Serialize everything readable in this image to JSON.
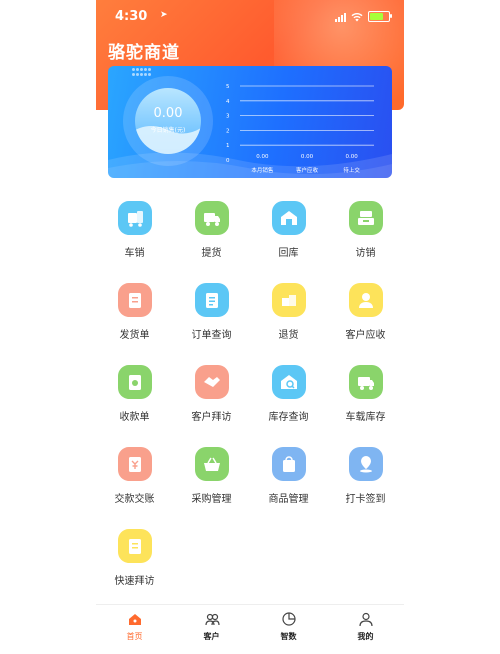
{
  "status_bar": {
    "time": "4:30",
    "location_glyph": "➤"
  },
  "header": {
    "title": "骆驼商道"
  },
  "summary_card": {
    "gauge_value": "0.00",
    "gauge_label": "今日销售(元)"
  },
  "chart_data": {
    "type": "bar",
    "categories": [
      "本月销售",
      "客户应收",
      "待上交"
    ],
    "values": [
      0.0,
      0.0,
      0.0
    ],
    "value_labels": [
      "0.00",
      "0.00",
      "0.00"
    ],
    "ylim": [
      0,
      5
    ],
    "yticks": [
      "0",
      "1",
      "2",
      "3",
      "4",
      "5"
    ],
    "grid": true,
    "title": "",
    "xlabel": "",
    "ylabel": ""
  },
  "menu": [
    {
      "label": "车销",
      "icon": "truck-doc-icon",
      "color": "#5cc7f5"
    },
    {
      "label": "提货",
      "icon": "truck-load-icon",
      "color": "#8ad46b"
    },
    {
      "label": "回库",
      "icon": "warehouse-icon",
      "color": "#5cc7f5"
    },
    {
      "label": "访销",
      "icon": "register-icon",
      "color": "#8ad46b"
    },
    {
      "label": "发货单",
      "icon": "invoice-icon",
      "color": "#f9a08c"
    },
    {
      "label": "订单查询",
      "icon": "order-list-icon",
      "color": "#5cc7f5"
    },
    {
      "label": "退货",
      "icon": "return-boxes-icon",
      "color": "#fde35a"
    },
    {
      "label": "客户应收",
      "icon": "receivable-icon",
      "color": "#fde35a"
    },
    {
      "label": "收款单",
      "icon": "receipt-icon",
      "color": "#8ad46b"
    },
    {
      "label": "客户拜访",
      "icon": "handshake-icon",
      "color": "#f9a08c"
    },
    {
      "label": "库存查询",
      "icon": "stock-search-icon",
      "color": "#5cc7f5"
    },
    {
      "label": "车载库存",
      "icon": "vehicle-stock-icon",
      "color": "#8ad46b"
    },
    {
      "label": "交款交账",
      "icon": "yuan-doc-icon",
      "color": "#f9a08c"
    },
    {
      "label": "采购管理",
      "icon": "basket-icon",
      "color": "#8ad46b"
    },
    {
      "label": "商品管理",
      "icon": "bag-icon",
      "color": "#7fb5f2"
    },
    {
      "label": "打卡签到",
      "icon": "location-pin-icon",
      "color": "#7fb5f2"
    },
    {
      "label": "快速拜访",
      "icon": "quick-visit-icon",
      "color": "#fde35a"
    }
  ],
  "tabs": [
    {
      "label": "首页",
      "icon": "home-icon",
      "active": true
    },
    {
      "label": "客户",
      "icon": "customers-icon",
      "active": false
    },
    {
      "label": "智数",
      "icon": "pie-chart-icon",
      "active": false
    },
    {
      "label": "我的",
      "icon": "profile-icon",
      "active": false
    }
  ],
  "colors": {
    "accent": "#ff6a2e",
    "card_blue": "#1e6fff"
  }
}
